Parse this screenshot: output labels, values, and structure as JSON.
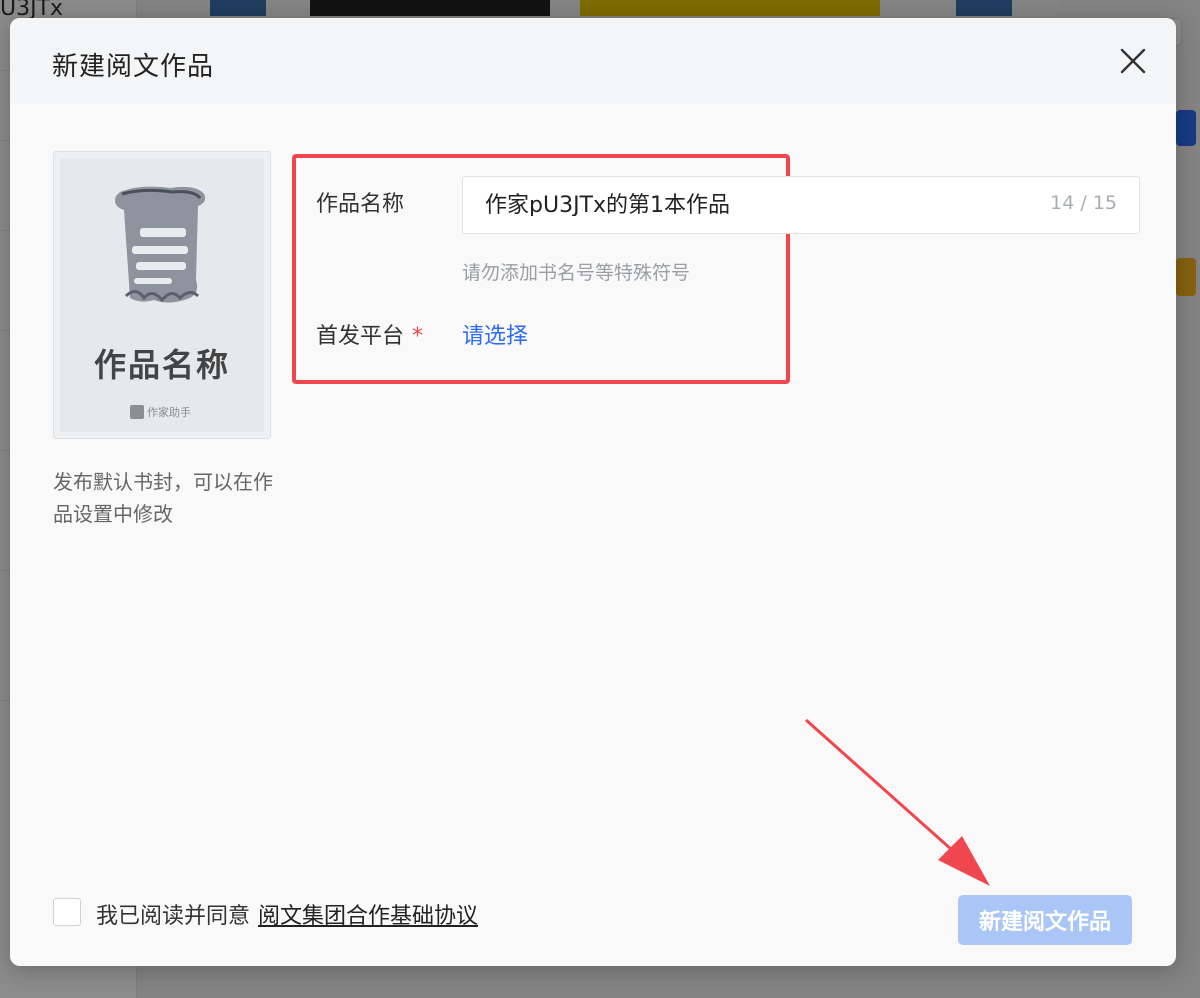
{
  "background": {
    "sidebar_text": "U3JTx"
  },
  "modal": {
    "title": "新建阅文作品",
    "cover": {
      "title": "作品名称",
      "brand": "作家助手",
      "note": "发布默认书封，可以在作品设置中修改"
    },
    "form": {
      "name_label": "作品名称",
      "name_value": "作家pU3JTx的第1本作品",
      "name_count": "14 / 15",
      "name_hint": "请勿添加书名号等特殊符号",
      "platform_label": "首发平台",
      "platform_required": "*",
      "platform_placeholder": "请选择"
    },
    "footer": {
      "agree_text": "我已阅读并同意",
      "agree_link": "阅文集团合作基础协议",
      "submit_label": "新建阅文作品"
    }
  },
  "colors": {
    "accent_blue": "#2d6cf0",
    "highlight_red": "#f0474e",
    "submit_disabled": "#a9c6f7"
  }
}
